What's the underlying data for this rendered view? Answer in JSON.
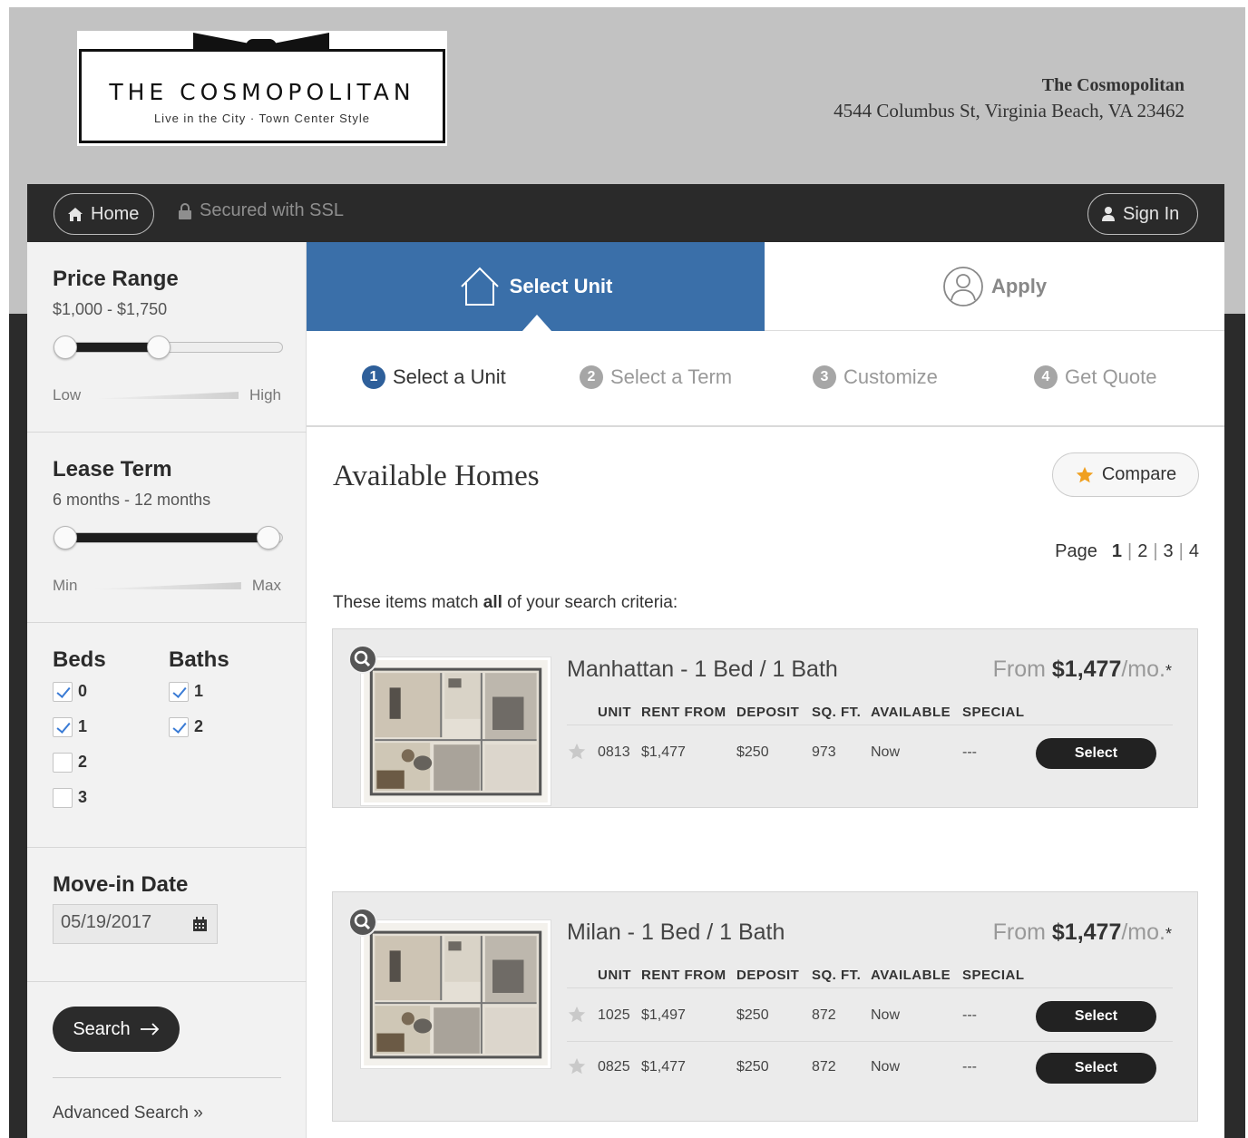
{
  "header": {
    "logo_title": "THE COSMOPOLITAN",
    "logo_tagline": "Live in the City · Town Center Style",
    "property_name": "The Cosmopolitan",
    "property_address": "4544 Columbus St, Virginia Beach, VA 23462"
  },
  "topbar": {
    "home_label": "Home",
    "ssl_label": "Secured with SSL",
    "signin_label": "Sign In"
  },
  "sidebar": {
    "price": {
      "title": "Price Range",
      "value": "$1,000 - $1,750",
      "low": "Low",
      "high": "High",
      "low_fraction": 0,
      "high_fraction": 0.46
    },
    "lease": {
      "title": "Lease Term",
      "value": "6 months - 12 months",
      "min": "Min",
      "max": "Max",
      "low_fraction": 0,
      "high_fraction": 1
    },
    "beds": {
      "title": "Beds",
      "options": [
        {
          "label": "0",
          "checked": true
        },
        {
          "label": "1",
          "checked": true
        },
        {
          "label": "2",
          "checked": false
        },
        {
          "label": "3",
          "checked": false
        }
      ]
    },
    "baths": {
      "title": "Baths",
      "options": [
        {
          "label": "1",
          "checked": true
        },
        {
          "label": "2",
          "checked": true
        }
      ]
    },
    "movein": {
      "title": "Move-in Date",
      "value": "05/19/2017"
    },
    "search_label": "Search",
    "advanced_label": "Advanced Search »"
  },
  "tabs": {
    "select_unit": "Select Unit",
    "apply": "Apply"
  },
  "steps": [
    {
      "num": "1",
      "label": "Select a Unit"
    },
    {
      "num": "2",
      "label": "Select a Term"
    },
    {
      "num": "3",
      "label": "Customize"
    },
    {
      "num": "4",
      "label": "Get Quote"
    }
  ],
  "results": {
    "title": "Available Homes",
    "compare_label": "Compare",
    "page_label": "Page",
    "pages": [
      "1",
      "2",
      "3",
      "4"
    ],
    "current_page": "1",
    "criteria_pre": "These items match ",
    "criteria_bold": "all",
    "criteria_post": " of your search criteria:",
    "columns": [
      "UNIT",
      "RENT FROM",
      "DEPOSIT",
      "SQ. FT.",
      "AVAILABLE",
      "SPECIAL"
    ],
    "select_label": "Select"
  },
  "floorplans": [
    {
      "name": "Manhattan - 1 Bed / 1 Bath",
      "from_label": "From ",
      "price": "$1,477",
      "suffix": "/mo.",
      "asterisk": "*",
      "units": [
        {
          "unit": "0813",
          "rent": "$1,477",
          "deposit": "$250",
          "sqft": "973",
          "available": "Now",
          "special": "---"
        }
      ]
    },
    {
      "name": "Milan - 1 Bed / 1 Bath",
      "from_label": "From ",
      "price": "$1,477",
      "suffix": "/mo.",
      "asterisk": "*",
      "units": [
        {
          "unit": "1025",
          "rent": "$1,497",
          "deposit": "$250",
          "sqft": "872",
          "available": "Now",
          "special": "---"
        },
        {
          "unit": "0825",
          "rent": "$1,477",
          "deposit": "$250",
          "sqft": "872",
          "available": "Now",
          "special": "---"
        }
      ]
    }
  ]
}
